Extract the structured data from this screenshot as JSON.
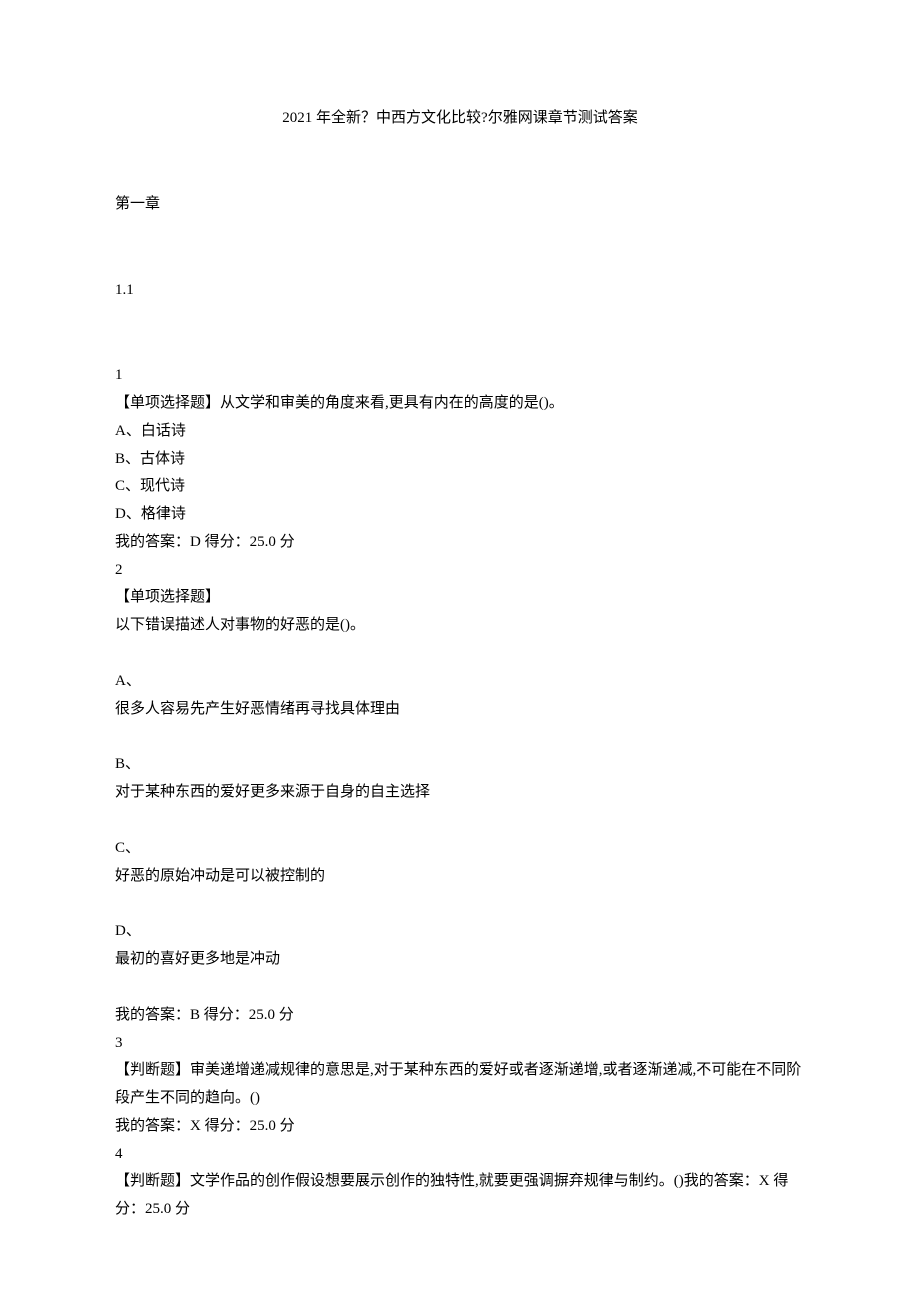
{
  "title": "2021 年全新？中西方文化比较?尔雅网课章节测试答案",
  "chapter": "第一章",
  "subsection": "1.1",
  "q1": {
    "number": "1",
    "stem": "【单项选择题】从文学和审美的角度来看,更具有内在的高度的是()。",
    "optA": "A、白话诗",
    "optB": "B、古体诗",
    "optC": "C、现代诗",
    "optD": "D、格律诗",
    "answer": "我的答案：D 得分：25.0 分"
  },
  "q2": {
    "number": "2",
    "type": "【单项选择题】",
    "stem": "以下错误描述人对事物的好恶的是()。",
    "optAlabel": "A、",
    "optAtext": "很多人容易先产生好恶情绪再寻找具体理由",
    "optBlabel": "B、",
    "optBtext": "对于某种东西的爱好更多来源于自身的自主选择",
    "optClabel": "C、",
    "optCtext": "好恶的原始冲动是可以被控制的",
    "optDlabel": "D、",
    "optDtext": "最初的喜好更多地是冲动",
    "answer": "我的答案：B 得分：25.0 分"
  },
  "q3": {
    "number": "3",
    "stem": "【判断题】审美递增递减规律的意思是,对于某种东西的爱好或者逐渐递增,或者逐渐递减,不可能在不同阶段产生不同的趋向。()",
    "answer": "我的答案：X 得分：25.0 分"
  },
  "q4": {
    "number": "4",
    "stem": "【判断题】文学作品的创作假设想要展示创作的独特性,就要更强调摒弃规律与制约。()我的答案：X 得分：25.0 分"
  }
}
